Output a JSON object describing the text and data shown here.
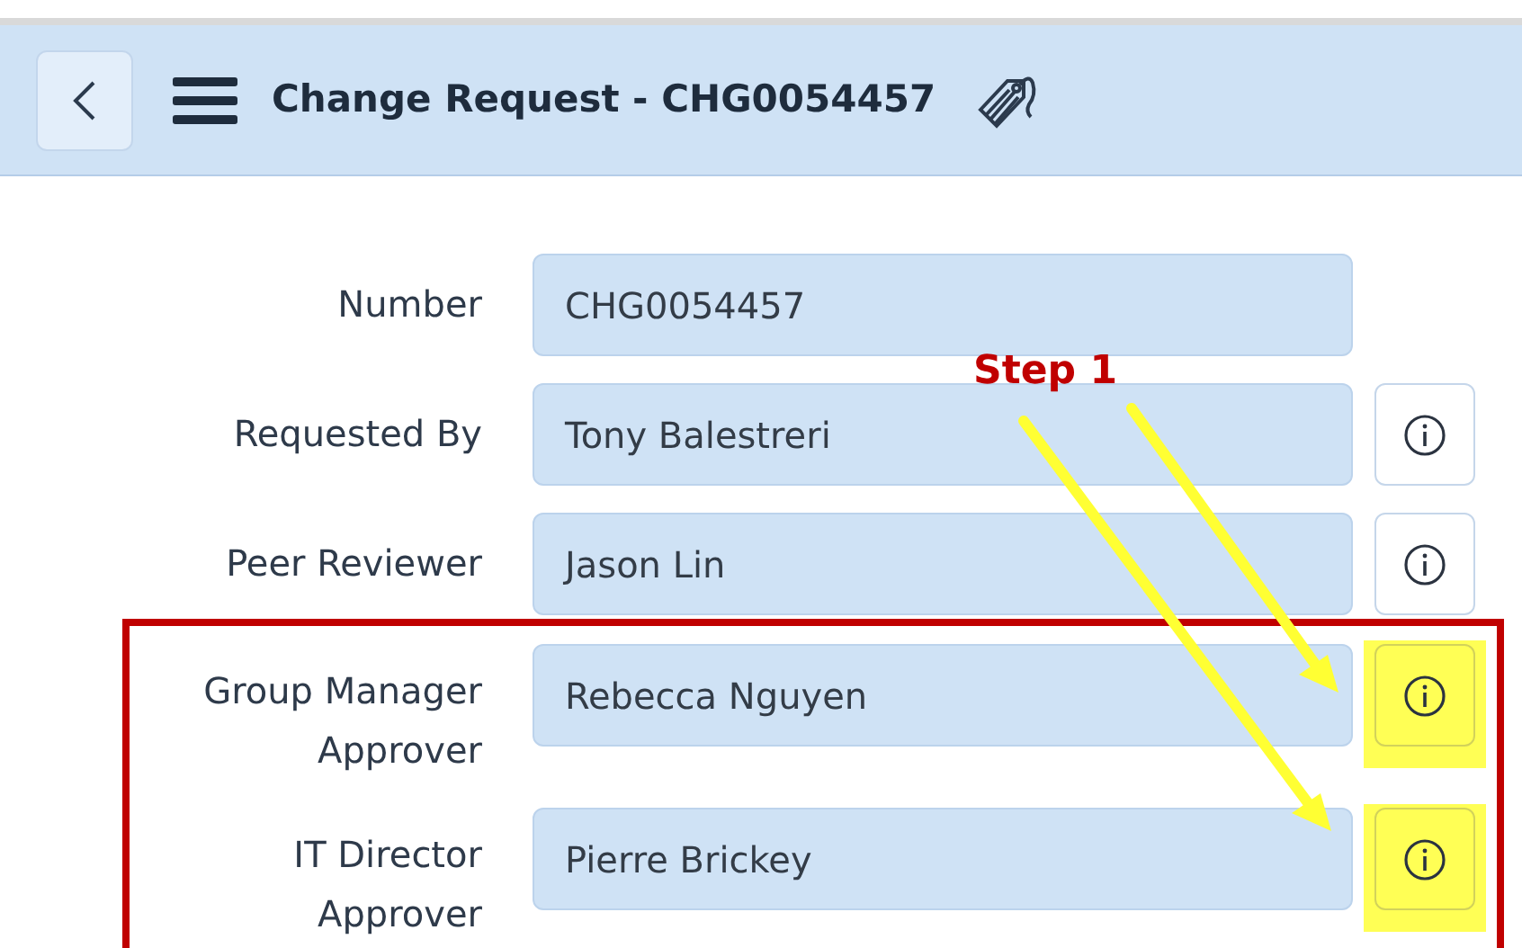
{
  "header": {
    "title": "Change Request - CHG0054457"
  },
  "fields": [
    {
      "label": "Number",
      "value": "CHG0054457",
      "info_button": false,
      "highlighted": false,
      "outlined": false
    },
    {
      "label": "Requested By",
      "value": "Tony Balestreri",
      "info_button": true,
      "highlighted": false,
      "outlined": false
    },
    {
      "label": "Peer Reviewer",
      "value": "Jason Lin",
      "info_button": true,
      "highlighted": false,
      "outlined": false
    },
    {
      "label": "Group Manager Approver",
      "value": "Rebecca Nguyen",
      "info_button": true,
      "highlighted": true,
      "outlined": true
    },
    {
      "label": "IT Director Approver",
      "value": "Pierre Brickey",
      "info_button": true,
      "highlighted": true,
      "outlined": true
    }
  ],
  "annotation": {
    "label": "Step 1"
  }
}
